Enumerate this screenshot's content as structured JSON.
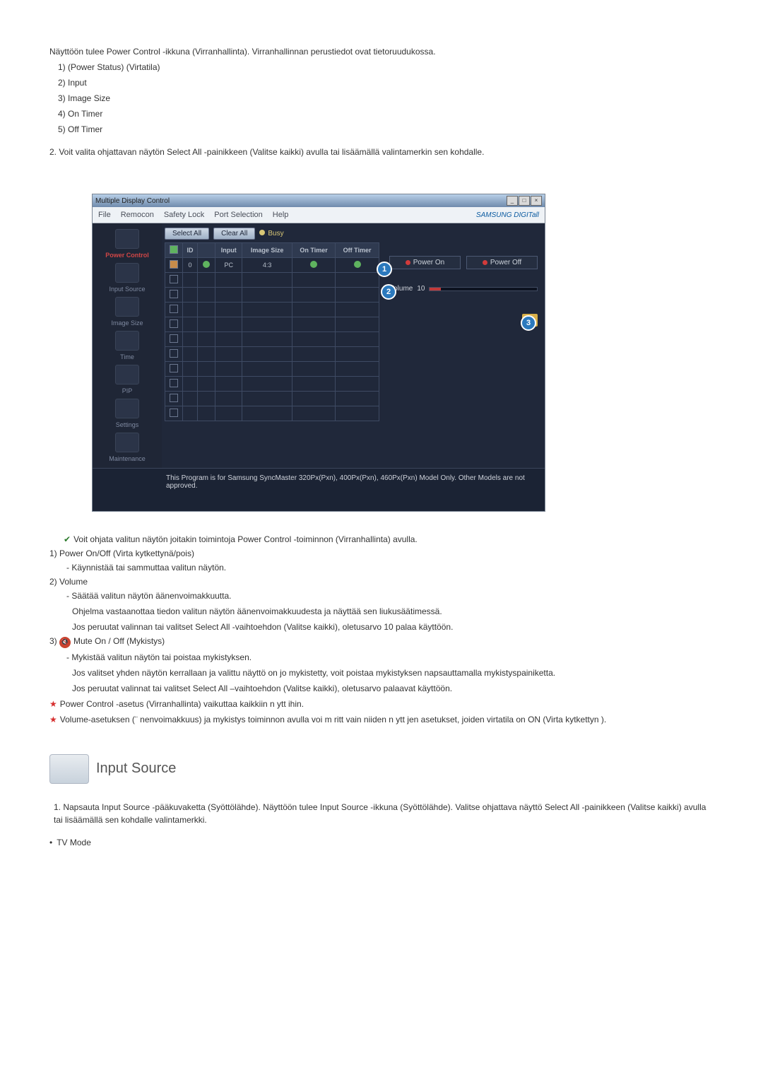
{
  "intro": {
    "p1": "Näyttöön tulee Power Control -ikkuna (Virranhallinta). Virranhallinnan perustiedot ovat tietoruudukossa.",
    "items": [
      "1)     (Power Status) (Virtatila)",
      "2) Input",
      "3) Image Size",
      "4) On Timer",
      "5) Off Timer"
    ],
    "p2": "2.  Voit valita ohjattavan näytön Select All -painikkeen (Valitse kaikki) avulla tai lisäämällä valintamerkin sen kohdalle."
  },
  "app": {
    "title": "Multiple Display Control",
    "menus": [
      "File",
      "Remocon",
      "Safety Lock",
      "Port Selection",
      "Help"
    ],
    "brand": "SAMSUNG DIGITall",
    "toolbar": {
      "select_all": "Select All",
      "clear_all": "Clear All",
      "busy": "Busy"
    },
    "sidebar": [
      {
        "label": "Power Control",
        "active": true
      },
      {
        "label": "Input Source"
      },
      {
        "label": "Image Size"
      },
      {
        "label": "Time"
      },
      {
        "label": "PIP"
      },
      {
        "label": "Settings"
      },
      {
        "label": "Maintenance"
      }
    ],
    "grid": {
      "headers": [
        "",
        "ID",
        "",
        "Input",
        "Image Size",
        "On Timer",
        "Off Timer"
      ],
      "row": {
        "id": "0",
        "input": "PC",
        "image_size": "4:3"
      }
    },
    "right": {
      "power_on": "Power On",
      "power_off": "Power Off",
      "volume_label": "Volume",
      "volume_value": "10"
    },
    "callouts": {
      "c1": "1",
      "c2": "2",
      "c3": "3"
    },
    "footer": "This Program is for Samsung SyncMaster 320Px(Pxn), 400Px(Pxn), 460Px(Pxn)  Model Only. Other Models are not approved."
  },
  "below": {
    "check_line": "Voit ohjata valitun näytön joitakin toimintoja Power Control -toiminnon (Virranhallinta) avulla.",
    "i1_h": "1)  Power On/Off (Virta kytkettynä/pois)",
    "i1_a": "- Käynnistää tai sammuttaa valitun näytön.",
    "i2_h": "2)  Volume",
    "i2_a": "- Säätää valitun näytön äänenvoimakkuutta.",
    "i2_b": "Ohjelma vastaanottaa tiedon valitun näytön äänenvoimakkuudesta ja näyttää sen liukusäätimessä.",
    "i2_c": "Jos peruutat valinnan tai valitset Select All -vaihtoehdon (Valitse kaikki), oletusarvo 10 palaa käyttöön.",
    "i3_h": "Mute On / Off (Mykistys)",
    "i3_a": "- Mykistää valitun näytön tai poistaa mykistyksen.",
    "i3_b": "Jos valitset yhden näytön kerrallaan ja valittu näyttö on jo mykistetty, voit poistaa mykistyksen napsauttamalla mykistyspainiketta.",
    "i3_c": "Jos peruutat valinnat tai valitset Select All –vaihtoehdon (Valitse kaikki), oletusarvo palaavat käyttöön.",
    "star1": "Power Control -asetus (Virranhallinta) vaikuttaa kaikkiin n ytt ihin.",
    "star2": "Volume-asetuksen (¨ nenvoimakkuus) ja mykistys          toiminnon avulla voi m  ritt   vain niiden n ytt jen asetukset, joiden virtatila on ON (Virta kytkettyn )."
  },
  "input_source": {
    "heading": "Input Source",
    "p1": "1.  Napsauta Input Source -pääkuvaketta (Syöttölähde). Näyttöön tulee Input Source -ikkuna (Syöttölähde). Valitse ohjattava näyttö Select All -painikkeen (Valitse kaikki) avulla tai lisäämällä sen kohdalle valintamerkki.",
    "p2": "TV Mode"
  }
}
